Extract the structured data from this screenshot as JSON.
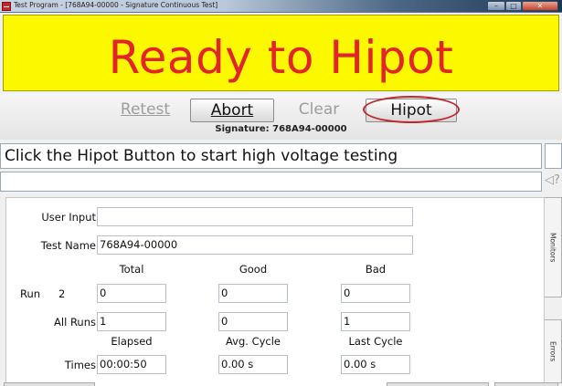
{
  "window": {
    "title": "Test Program - [768A94-00000 - Signature Continuous Test]",
    "min_glyph": "–",
    "max_glyph": "□",
    "close_glyph": "✕"
  },
  "banner": {
    "status_text": "Ready to Hipot",
    "background": "#fcf800",
    "text_color": "#e1252a"
  },
  "toolbar": {
    "retest_label": "Retest",
    "abort_label": "Abort",
    "clear_label": "Clear",
    "hipot_label": "Hipot",
    "signature": "Signature: 768A94-00000"
  },
  "instruction": "Click the Hipot Button to start high voltage testing",
  "message": "",
  "nav_arrows": "◁?",
  "form": {
    "user_input_label": "User Input",
    "user_input_value": "",
    "test_name_label": "Test Name",
    "test_name_value": "768A94-00000",
    "headers": {
      "total": "Total",
      "good": "Good",
      "bad": "Bad"
    },
    "run_label": "Run",
    "run_number": "2",
    "run_total": "0",
    "run_good": "0",
    "run_bad": "0",
    "all_runs_label": "All Runs",
    "all_total": "1",
    "all_good": "0",
    "all_bad": "1",
    "time_headers": {
      "elapsed": "Elapsed",
      "avg_cycle": "Avg. Cycle",
      "last_cycle": "Last Cycle"
    },
    "times_label": "Times",
    "elapsed": "00:00:50",
    "avg_cycle": "0.00 s",
    "last_cycle": "0.00 s"
  },
  "side_tabs": {
    "monitors": "Monitors",
    "errors": "Errors"
  }
}
